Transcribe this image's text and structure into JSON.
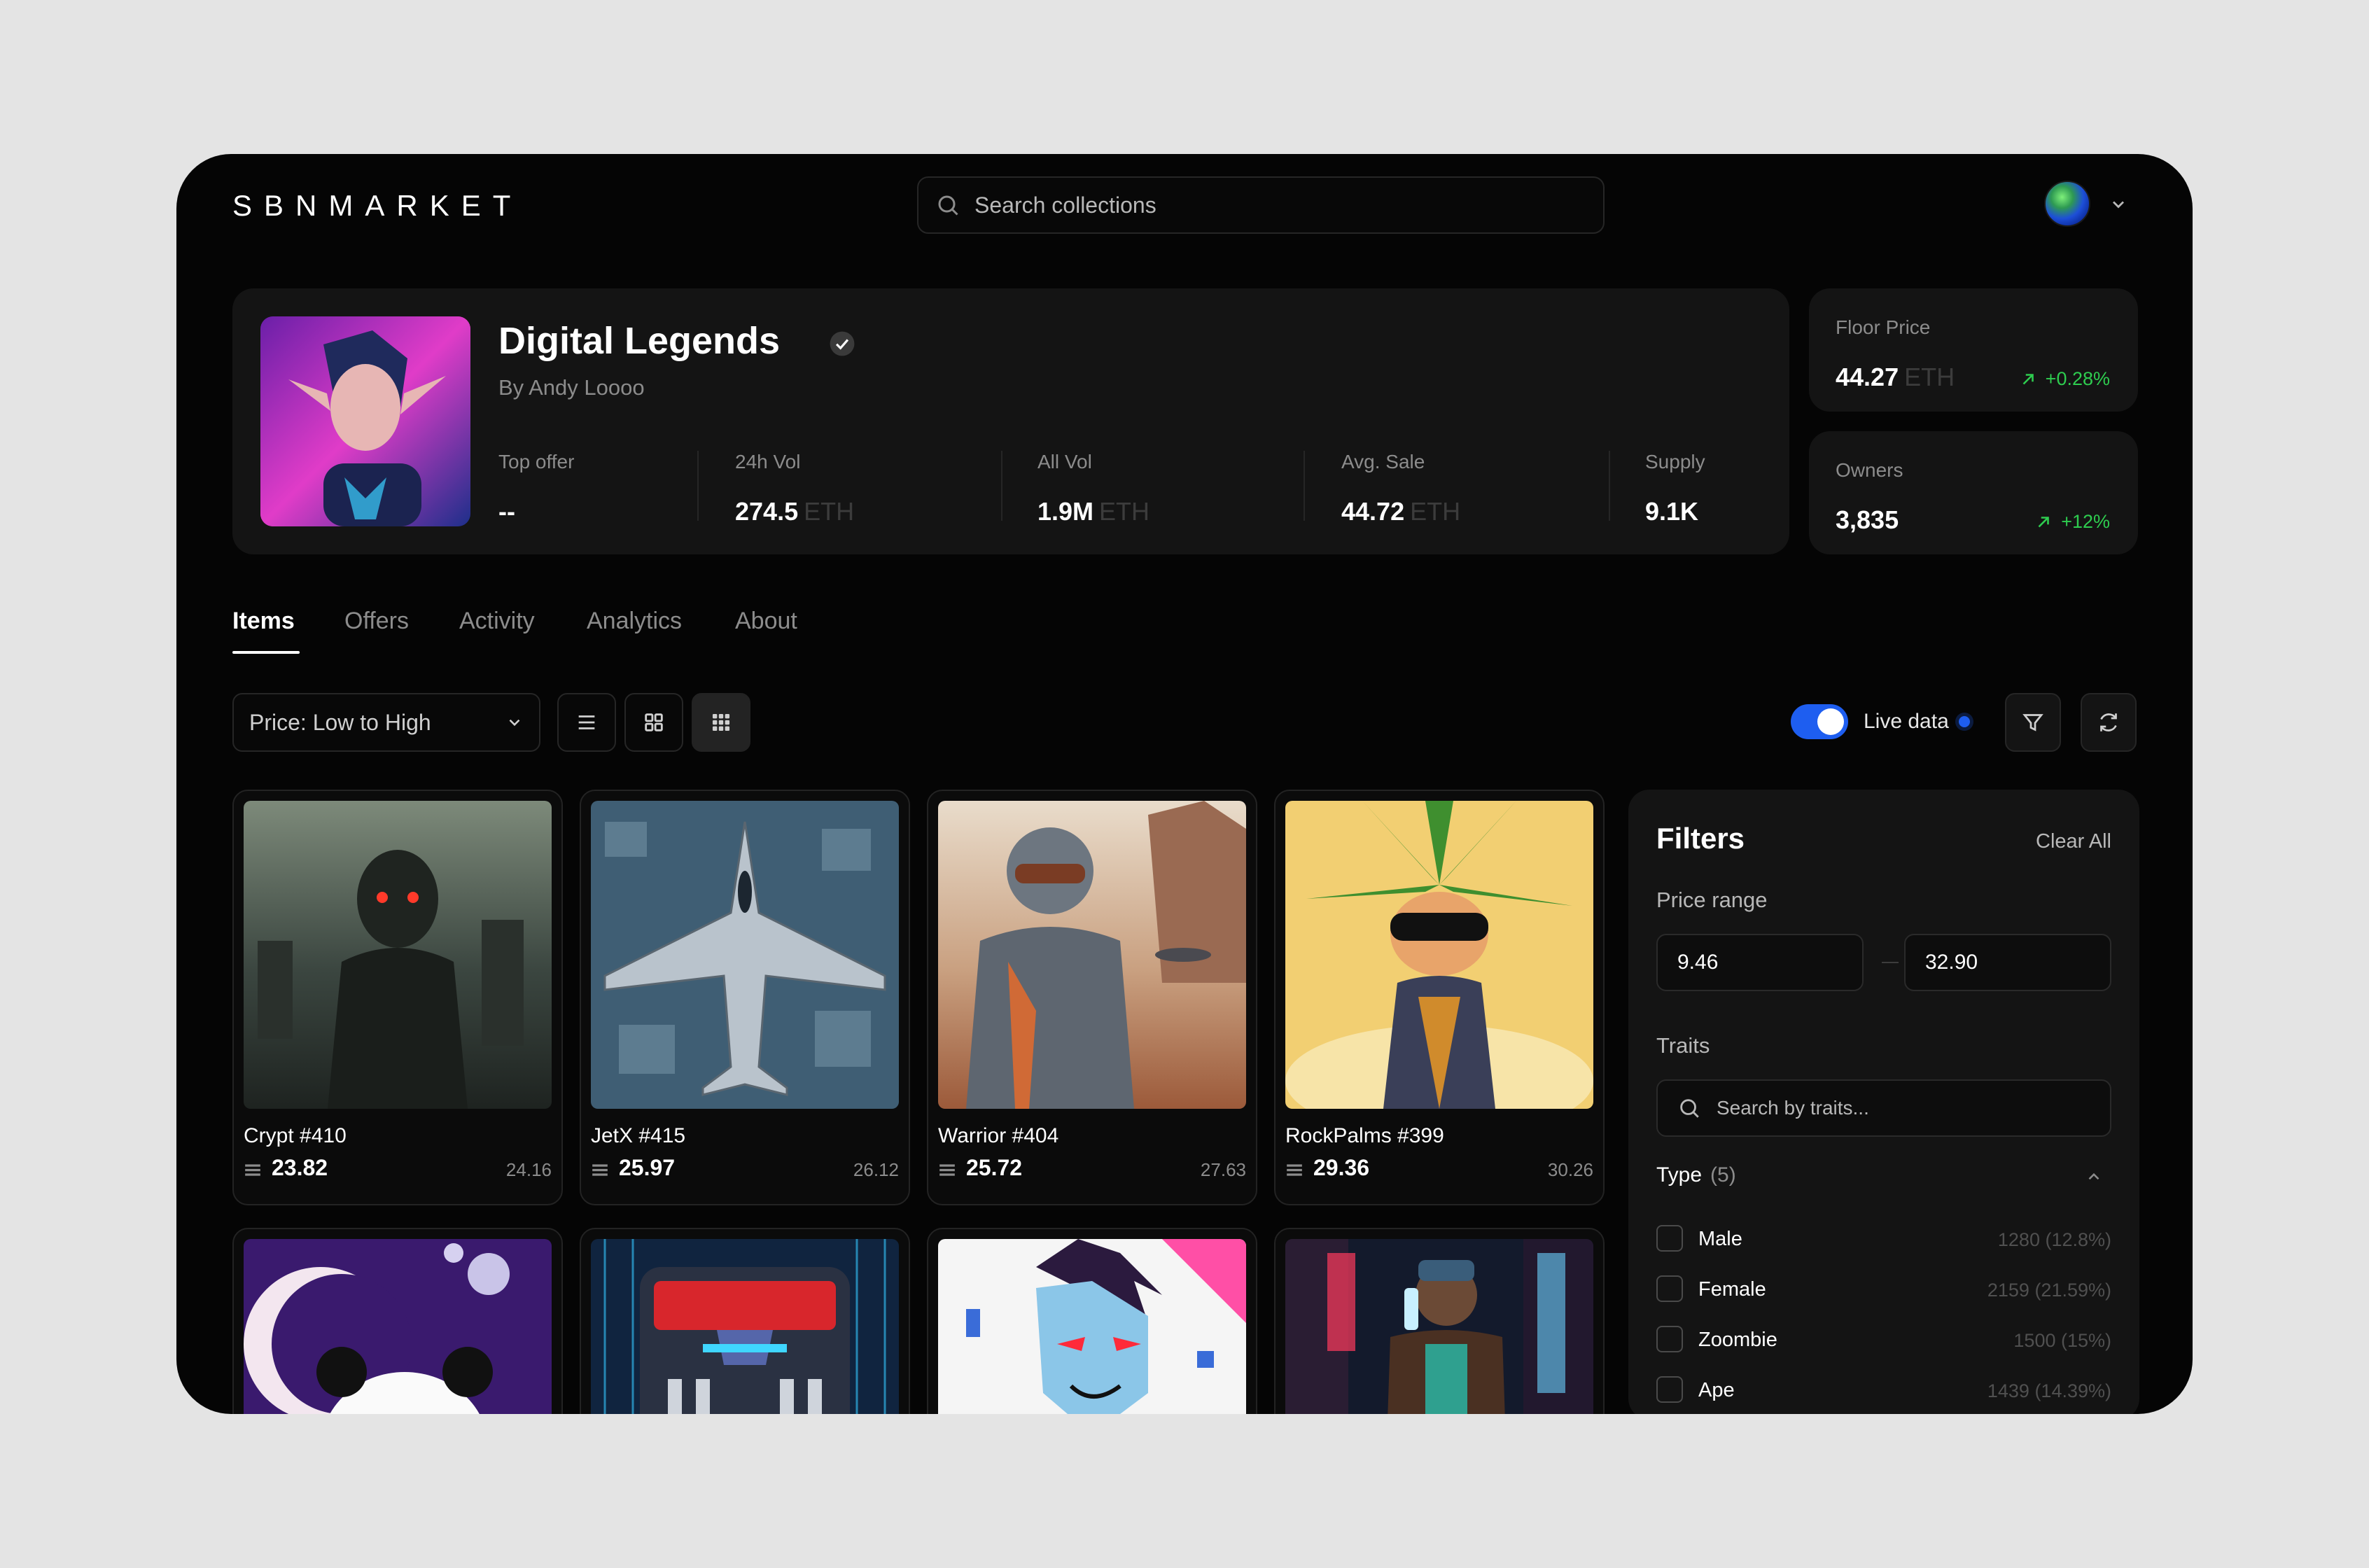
{
  "brand": {
    "logo": "SBNMARKET"
  },
  "header": {
    "search_placeholder": "Search collections"
  },
  "collection": {
    "title": "Digital Legends",
    "creator": "By Andy Loooo",
    "stats": [
      {
        "label": "Top offer",
        "value": "--",
        "unit": ""
      },
      {
        "label": "24h Vol",
        "value": "274.5",
        "unit": "ETH"
      },
      {
        "label": "All Vol",
        "value": "1.9M",
        "unit": "ETH"
      },
      {
        "label": "Avg. Sale",
        "value": "44.72",
        "unit": "ETH"
      },
      {
        "label": "Supply",
        "value": "9.1K",
        "unit": ""
      }
    ],
    "floor": {
      "label": "Floor Price",
      "value": "44.27",
      "unit": "ETH",
      "change": "+0.28%"
    },
    "owners": {
      "label": "Owners",
      "value": "3,835",
      "change": "+12%"
    }
  },
  "tabs": [
    "Items",
    "Offers",
    "Activity",
    "Analytics",
    "About"
  ],
  "toolbar": {
    "sort_label": "Price: Low to High",
    "live_label": "Live data",
    "live_on": true
  },
  "items": [
    {
      "name": "Crypt #410",
      "price": "23.82",
      "last": "24.16"
    },
    {
      "name": "JetX #415",
      "price": "25.97",
      "last": "26.12"
    },
    {
      "name": "Warrior #404",
      "price": "25.72",
      "last": "27.63"
    },
    {
      "name": "RockPalms #399",
      "price": "29.36",
      "last": "30.26"
    }
  ],
  "filters": {
    "title": "Filters",
    "clear": "Clear All",
    "price_range_label": "Price range",
    "price_min": "9.46",
    "price_max": "32.90",
    "traits_label": "Traits",
    "traits_placeholder": "Search by traits...",
    "type_label": "Type",
    "type_count": "(5)",
    "type_options": [
      {
        "label": "Male",
        "count": "1280 (12.8%)"
      },
      {
        "label": "Female",
        "count": "2159 (21.59%)"
      },
      {
        "label": "Zoombie",
        "count": "1500 (15%)"
      },
      {
        "label": "Ape",
        "count": "1439 (14.39%)"
      }
    ]
  },
  "colors": {
    "accent": "#1e5ef0",
    "positive": "#2ecc4f",
    "surface": "#141414",
    "background": "#050505"
  }
}
